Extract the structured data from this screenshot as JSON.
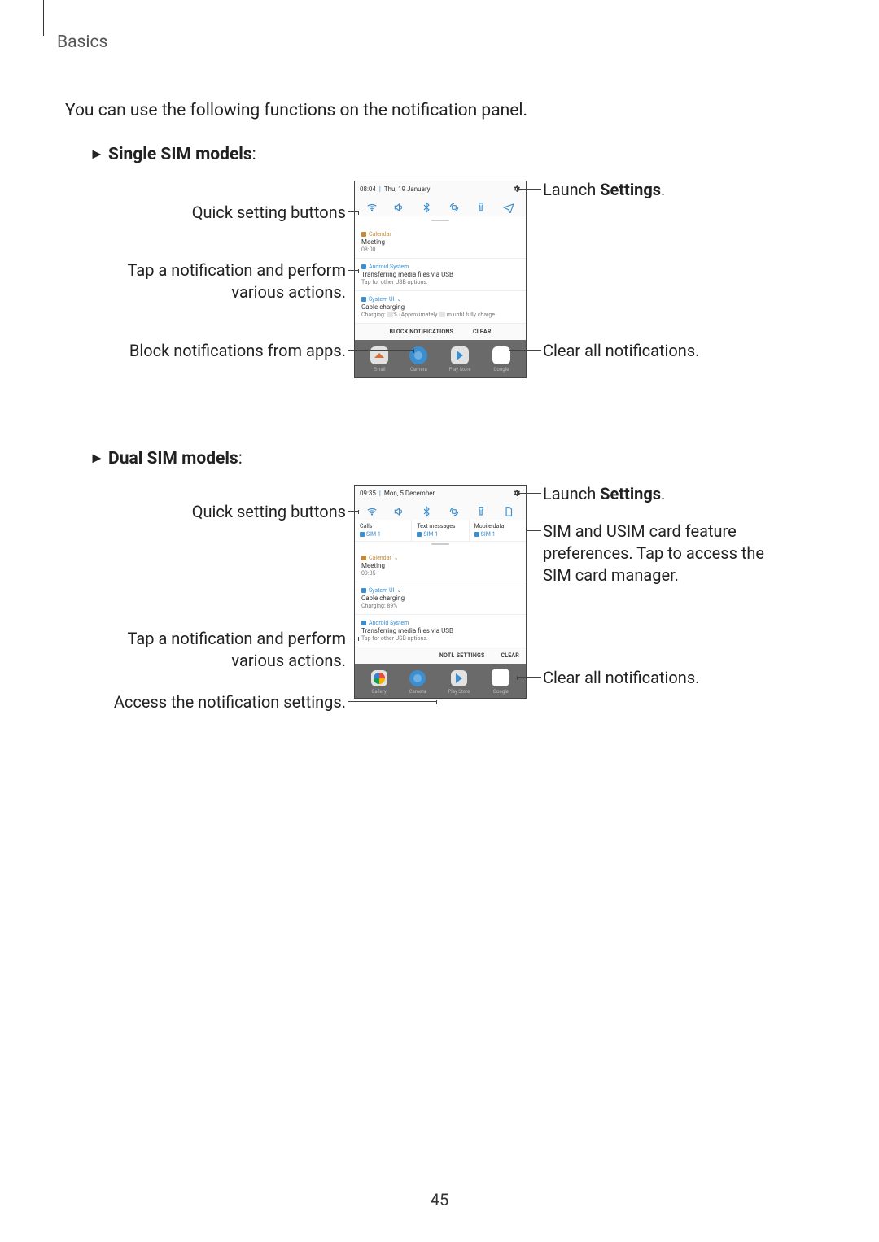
{
  "page": {
    "header": "Basics",
    "intro": "You can use the following functions on the notification panel.",
    "pagenum": "45"
  },
  "sections": {
    "single": {
      "prefix": "►",
      "label": "Single SIM models",
      "suffix": ":"
    },
    "dual": {
      "prefix": "►",
      "label": "Dual SIM models",
      "suffix": ":"
    }
  },
  "callouts": {
    "settings_prefix": "Launch ",
    "settings_bold": "Settings",
    "settings_suffix": ".",
    "quick_setting": "Quick setting buttons",
    "tap_notif_l1": "Tap a notification and perform",
    "tap_notif_l2": "various actions.",
    "block_notif": "Block notifications from apps.",
    "clear_all": "Clear all notifications.",
    "sim_pref_l1": "SIM and USIM card feature",
    "sim_pref_l2": "preferences. Tap to access the",
    "sim_pref_l3": "SIM card manager.",
    "noti_settings": "Access the notification settings."
  },
  "phone1": {
    "time": "08:04",
    "date": "Thu, 19 January",
    "notifs": [
      {
        "app": "Calendar",
        "title": "Meeting",
        "sub": "08:00",
        "color": "orange"
      },
      {
        "app": "Android System",
        "title": "Transferring media files via USB",
        "sub": "Tap for other USB options.",
        "color": "blue"
      },
      {
        "app": "System UI",
        "title": "Cable charging",
        "sub_pre": "Charging: ",
        "sub_mid": "% (Approximately ",
        "sub_post": " m until fully charge..",
        "chevron": "⌄",
        "color": "blue",
        "chips": true
      }
    ],
    "actions": {
      "block": "BLOCK NOTIFICATIONS",
      "clear": "CLEAR"
    },
    "dock": [
      "Email",
      "Camera",
      "Play Store",
      "Google"
    ]
  },
  "phone2": {
    "time": "09:35",
    "date": "Mon, 5 December",
    "sim": {
      "cells": [
        {
          "title": "Calls",
          "sub": "SIM 1"
        },
        {
          "title": "Text messages",
          "sub": "SIM 1"
        },
        {
          "title": "Mobile data",
          "sub": "SIM 1"
        }
      ]
    },
    "notifs": [
      {
        "app": "Calendar",
        "chevron": "⌄",
        "title": "Meeting",
        "sub": "09:35",
        "color": "orange"
      },
      {
        "app": "System UI",
        "chevron": "⌄",
        "title": "Cable charging",
        "sub": "Charging: 89%",
        "color": "blue"
      },
      {
        "app": "Android System",
        "title": "Transferring media files via USB",
        "sub": "Tap for other USB options.",
        "color": "blue"
      }
    ],
    "actions": {
      "settings": "NOTI. SETTINGS",
      "clear": "CLEAR"
    },
    "dock": [
      "Gallery",
      "Camera",
      "Play Store",
      "Google"
    ]
  }
}
